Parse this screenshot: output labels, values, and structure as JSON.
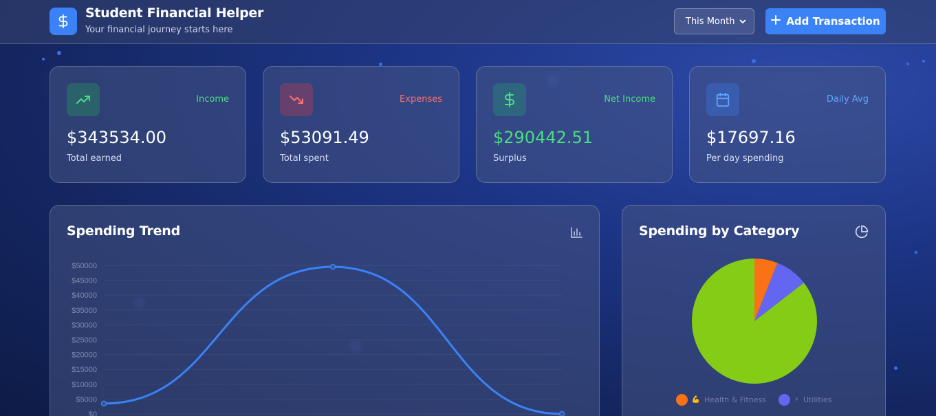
{
  "header": {
    "title": "Student Financial Helper",
    "subtitle": "Your financial journey starts here",
    "logo_icon": "dollar-icon",
    "period_select": {
      "selected": "This Month"
    },
    "add_button_label": "Add Transaction"
  },
  "stats": [
    {
      "label": "Income",
      "value": "$343534.00",
      "sub": "Total earned",
      "icon": "trending-up-icon",
      "label_color": "#4ade80",
      "value_color": "#ffffff"
    },
    {
      "label": "Expenses",
      "value": "$53091.49",
      "sub": "Total spent",
      "icon": "trending-down-icon",
      "label_color": "#f87171",
      "value_color": "#ffffff"
    },
    {
      "label": "Net Income",
      "value": "$290442.51",
      "sub": "Surplus",
      "icon": "dollar-icon",
      "label_color": "#4ade80",
      "value_color": "#4ade80"
    },
    {
      "label": "Daily Avg",
      "value": "$17697.16",
      "sub": "Per day spending",
      "icon": "calendar-icon",
      "label_color": "#60a5fa",
      "value_color": "#ffffff"
    }
  ],
  "trend_panel": {
    "title": "Spending Trend",
    "icon": "bar-chart-icon"
  },
  "category_panel": {
    "title": "Spending by Category",
    "icon": "pie-chart-icon",
    "legend": [
      {
        "emoji": "💪",
        "label": "Health & Fitness",
        "color": "#f97316"
      },
      {
        "emoji": "⚡",
        "label": "Utilities",
        "color": "#6366f1"
      }
    ]
  },
  "chart_data": [
    {
      "type": "line",
      "title": "Spending Trend",
      "y_ticks": [
        "$0",
        "$5000",
        "$10000",
        "$15000",
        "$20000",
        "$25000",
        "$30000",
        "$35000",
        "$40000",
        "$45000",
        "$50000"
      ],
      "ylim": [
        0,
        50000
      ],
      "series": [
        {
          "color": "#3b82f6",
          "values": [
            3500,
            49500,
            0
          ]
        }
      ],
      "grid": true
    },
    {
      "type": "pie",
      "title": "Spending by Category",
      "slices": [
        {
          "label": "Health & Fitness",
          "value": 6.0,
          "color": "#f97316"
        },
        {
          "label": "Utilities",
          "value": 8.5,
          "color": "#6366f1"
        },
        {
          "label": "",
          "value": 85.5,
          "color": "#84cc16"
        }
      ]
    }
  ]
}
